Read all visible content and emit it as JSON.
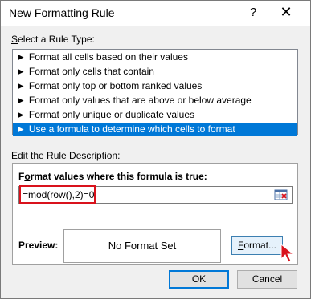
{
  "window": {
    "title": "New Formatting Rule",
    "help_glyph": "?",
    "close_glyph": "✕"
  },
  "rule_type": {
    "label_prefix": "S",
    "label_rest": "elect a Rule Type:",
    "items": [
      {
        "label": "Format all cells based on their values",
        "selected": false
      },
      {
        "label": "Format only cells that contain",
        "selected": false
      },
      {
        "label": "Format only top or bottom ranked values",
        "selected": false
      },
      {
        "label": "Format only values that are above or below average",
        "selected": false
      },
      {
        "label": "Format only unique or duplicate values",
        "selected": false
      },
      {
        "label": "Use a formula to determine which cells to format",
        "selected": true
      }
    ],
    "item_bullet": "►"
  },
  "description": {
    "label_prefix": "E",
    "label_rest": "dit the Rule Description:",
    "formula_label_prefix": "F",
    "formula_label_mid": "o",
    "formula_label_rest": "rmat values where this formula is true:",
    "formula_value": "=mod(row(),2)=0"
  },
  "preview": {
    "label": "Preview:",
    "text": "No Format Set"
  },
  "buttons": {
    "format_prefix": "F",
    "format_rest": "ormat...",
    "ok": "OK",
    "cancel": "Cancel"
  },
  "colors": {
    "selection": "#0078d7",
    "highlight": "#d9121c",
    "cursor": "#d9121c"
  }
}
